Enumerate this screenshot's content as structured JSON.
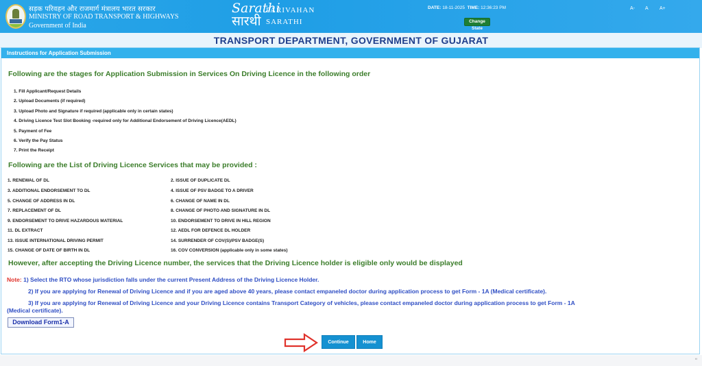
{
  "header": {
    "ministry_hindi": "सड़क परिवहन और राजमार्ग मंत्रालय भारत सरकार",
    "ministry_english": "MINISTRY OF ROAD TRANSPORT & HIGHWAYS",
    "government": "Government of India",
    "logo_text_line1": "PARIVAHAN",
    "logo_text_line2": "SARATHI",
    "date_label": "DATE:",
    "date_value": "18-11-2025",
    "time_label": "TIME:",
    "time_value": "12:36:23 PM",
    "change_state_label": "Change State",
    "font_size_options": [
      "A-",
      "A",
      "A+"
    ]
  },
  "department_title": "TRANSPORT DEPARTMENT, GOVERNMENT OF GUJARAT",
  "panel": {
    "title": "Instructions for Application Submission",
    "stages_heading": "Following are the stages for Application Submission in Services On Driving Licence in the following order",
    "stages": [
      "1. Fill Applicant/Request Details",
      "2. Upload Documents (if required)",
      "3. Upload Photo and Signature if required (applicable only in certain states)",
      "4. Driving Licence Test Slot Booking -required only for Additional Endorsement of Driving Licence(AEDL)",
      "5. Payment of Fee",
      "6. Verify the Pay Status",
      "7. Print the Receipt"
    ],
    "services_heading": "Following are the List of Driving Licence Services that may be provided :",
    "services_left": [
      "1. RENEWAL OF DL",
      "3. ADDITIONAL ENDORSEMENT TO DL",
      "5. CHANGE OF ADDRESS IN DL",
      "7. REPLACEMENT OF DL",
      "9. ENDORSEMENT TO DRIVE HAZARDOUS MATERIAL",
      "11. DL EXTRACT",
      "13. ISSUE INTERNATIONAL DRIVING PERMIT",
      "15. CHANGE OF DATE OF BIRTH IN DL"
    ],
    "services_right": [
      "2. ISSUE OF DUPLICATE DL",
      "4. ISSUE OF PSV BADGE TO A DRIVER",
      "6. CHANGE OF NAME IN DL",
      "8. CHANGE OF PHOTO AND SIGNATURE IN DL",
      "10. ENDORSEMENT TO DRIVE IN HILL REGION",
      "12. AEDL FOR DEFENCE DL HOLDER",
      "14. SURRENDER OF COV(S)/PSV BADGE(S)",
      "16. COV CONVERSION (applicable only in some states)"
    ],
    "however_text": "However, after accepting the Driving Licence number, the services that the Driving Licence holder is eligible only would be displayed",
    "note_label": "Note:",
    "note_1": "1) Select the RTO whose jurisdiction falls under the current Present Address of the Driving Licence Holder.",
    "note_2": "2) If you are applying for Renewal of Driving Licence and if you are aged above 40 years, please contact empaneled doctor during application process to get Form - 1A (Medical certificate).",
    "note_3a": "3) If you are applying for Renewal of Driving Licence and your Driving Licence contains Transport Category of vehicles, please contact empaneled doctor during application process to get Form - 1A",
    "note_3b": "(Medical certificate).",
    "download_label": "Download Form1-A",
    "continue_label": "Continue",
    "home_label": "Home"
  },
  "colors": {
    "header_blue": "#2aa6e8",
    "panel_head": "#33b1ec",
    "heading_green": "#3b7d2a",
    "note_blue": "#2f4ec4",
    "note_red": "#e0322b",
    "button_blue": "#1591d1",
    "arrow_red": "#e0322b"
  },
  "icons": {
    "emblem": "national-emblem-icon",
    "pointer_arrow": "right-arrow-icon"
  }
}
